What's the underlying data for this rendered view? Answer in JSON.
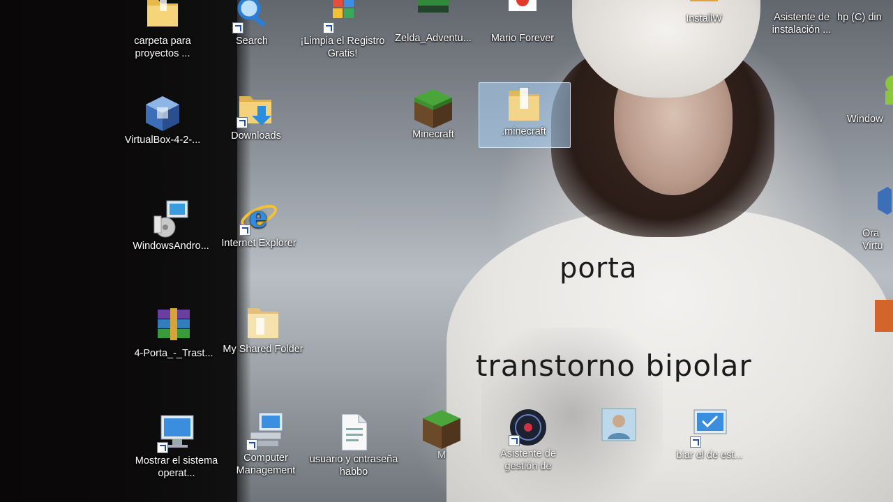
{
  "icons": {
    "carpeta": "carpeta para proyectos ...",
    "search": "Search",
    "limpia": "¡Limpia el Registro Gratis!",
    "zelda": "Zelda_Adventu...",
    "mario": "Mario Forever",
    "install": "InstallW",
    "asistente": "Asistente de instalación ...",
    "hp": "hp (C) din",
    "virtualbox": "VirtualBox-4-2-...",
    "downloads": "Downloads",
    "minecraft": "Minecraft",
    "dotminecraft": ".minecraft",
    "windows_right": "Window",
    "windowsandro": "WindowsAndro...",
    "ie": "Internet Explorer",
    "ora": "Ora Virtu",
    "porta_rar": "4-Porta_-_Trast...",
    "shared": "My Shared Folder",
    "mostrar": "Mostrar el sistema operat...",
    "computer": "Computer Management",
    "usuario": "usuario y cntraseña habbo",
    "minecraft2": "M",
    "asistente2": "Asistente de gestión de",
    "cambiar": "biar el de est..."
  },
  "wallpaper": {
    "line1": "porta",
    "line2": "transtorno bipolar"
  },
  "colors": {
    "desktop_dark": "#0b0909",
    "selection": "#aad2f5",
    "text_shadow": "#000000"
  }
}
